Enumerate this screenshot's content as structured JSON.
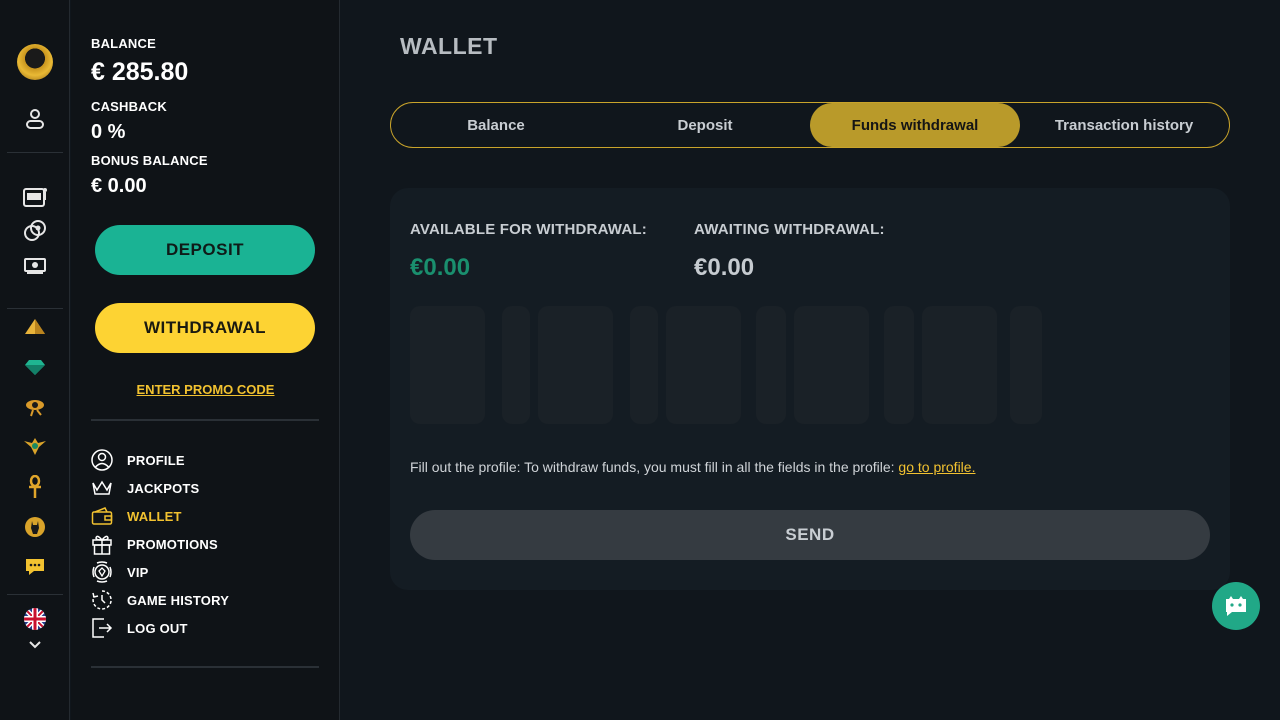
{
  "account": {
    "balance_label": "BALANCE",
    "balance_value": "€ 285.80",
    "cashback_label": "CASHBACK",
    "cashback_value": "0 %",
    "bonus_label": "BONUS BALANCE",
    "bonus_value": "€ 0.00",
    "deposit_label": "DEPOSIT",
    "withdrawal_label": "WITHDRAWAL",
    "promo_label": "ENTER PROMO CODE"
  },
  "menu": [
    {
      "label": "PROFILE",
      "icon": "profile-icon"
    },
    {
      "label": "JACKPOTS",
      "icon": "crown-icon"
    },
    {
      "label": "WALLET",
      "icon": "wallet-icon",
      "active": true
    },
    {
      "label": "PROMOTIONS",
      "icon": "gift-icon"
    },
    {
      "label": "VIP",
      "icon": "vip-icon"
    },
    {
      "label": "GAME HISTORY",
      "icon": "history-icon"
    },
    {
      "label": "LOG OUT",
      "icon": "logout-icon"
    }
  ],
  "page": {
    "title": "WALLET",
    "tabs": [
      "Balance",
      "Deposit",
      "Funds withdrawal",
      "Transaction history"
    ],
    "active_tab": "Funds withdrawal",
    "available_label": "AVAILABLE FOR WITHDRAWAL:",
    "available_value": "€0.00",
    "awaiting_label": "AWAITING WITHDRAWAL:",
    "awaiting_value": "€0.00",
    "note_text": "Fill out the profile: To withdraw funds, you must fill in all the fields in the profile: ",
    "note_link": "go to profile.",
    "send_label": "SEND"
  },
  "colors": {
    "accent_gold": "#f2c230",
    "deposit_green": "#1ab394",
    "withdraw_yellow": "#fdd333",
    "available_green": "#1a8f6e"
  }
}
